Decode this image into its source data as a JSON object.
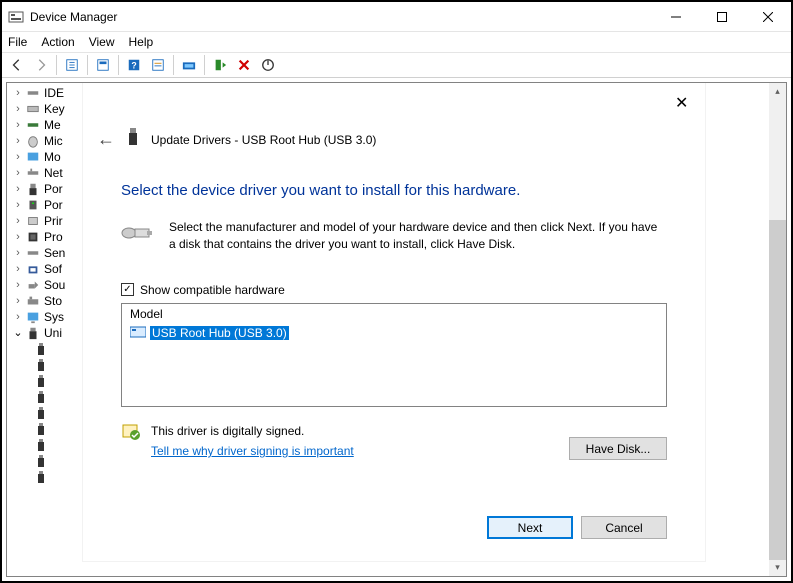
{
  "window": {
    "title": "Device Manager"
  },
  "menu": {
    "file": "File",
    "action": "Action",
    "view": "View",
    "help": "Help"
  },
  "tree": {
    "items": [
      {
        "label": "IDE"
      },
      {
        "label": "Key"
      },
      {
        "label": "Me"
      },
      {
        "label": "Mic"
      },
      {
        "label": "Mo"
      },
      {
        "label": "Net"
      },
      {
        "label": "Por"
      },
      {
        "label": "Por"
      },
      {
        "label": "Prir"
      },
      {
        "label": "Pro"
      },
      {
        "label": "Sen"
      },
      {
        "label": "Sof"
      },
      {
        "label": "Sou"
      },
      {
        "label": "Sto"
      },
      {
        "label": "Sys"
      },
      {
        "label": "Uni"
      }
    ]
  },
  "dialog": {
    "title": "Update Drivers - USB Root Hub (USB 3.0)",
    "heading": "Select the device driver you want to install for this hardware.",
    "instructions": "Select the manufacturer and model of your hardware device and then click Next. If you have a disk that contains the driver you want to install, click Have Disk.",
    "show_compatible": "Show compatible hardware",
    "model_header": "Model",
    "model_item": "USB Root Hub (USB 3.0)",
    "signed_text": "This driver is digitally signed.",
    "signing_link": "Tell me why driver signing is important",
    "have_disk": "Have Disk...",
    "next": "Next",
    "cancel": "Cancel"
  }
}
